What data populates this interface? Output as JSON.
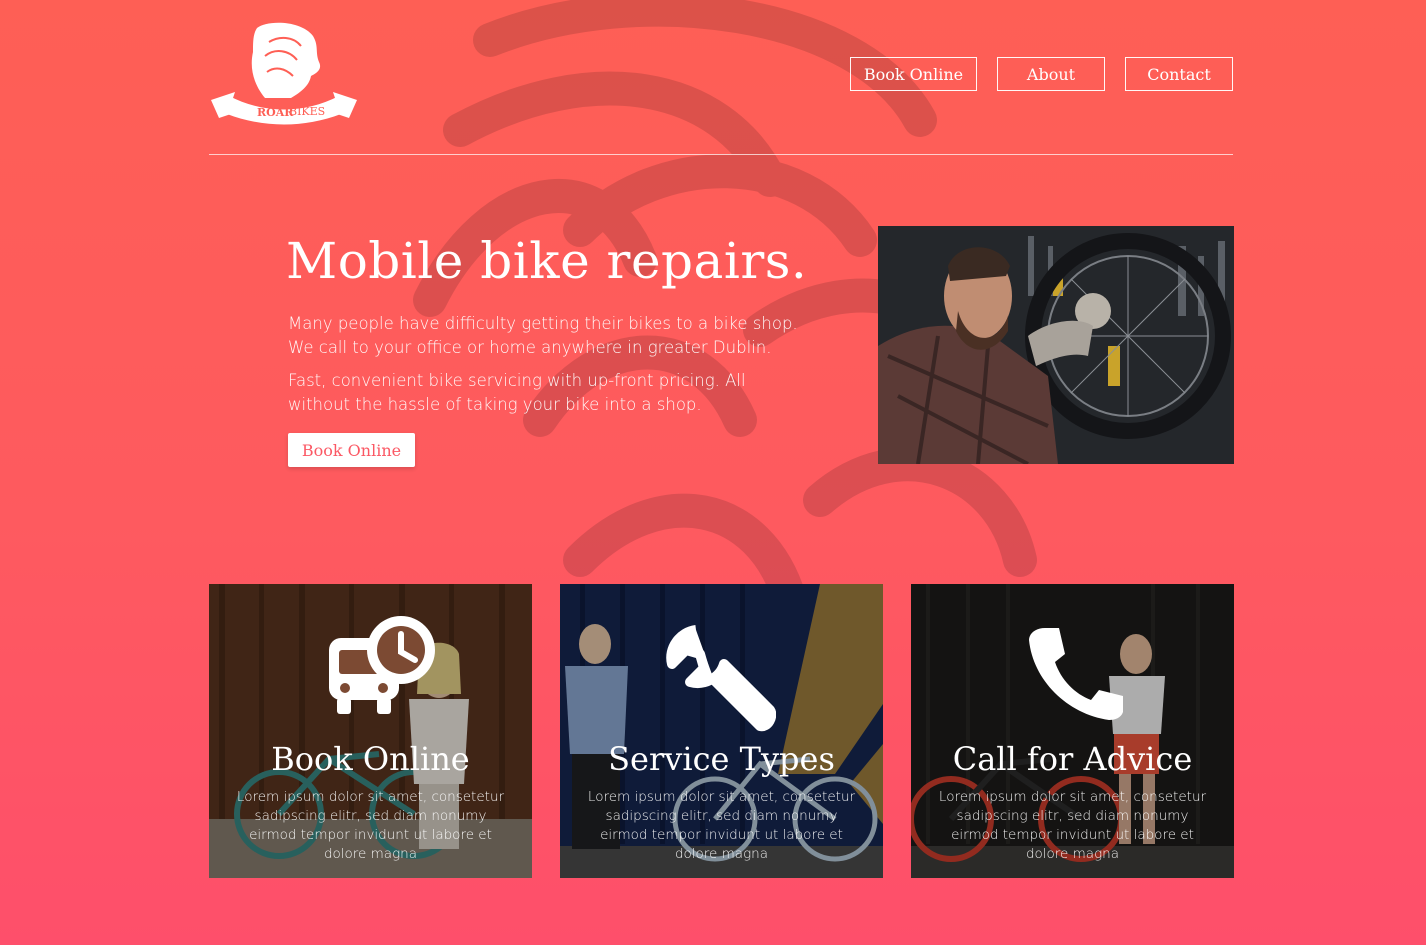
{
  "brand": {
    "logo_word1": "ROAR",
    "logo_word2": "BIKES"
  },
  "nav": {
    "items": [
      {
        "label": "Book Online"
      },
      {
        "label": "About"
      },
      {
        "label": "Contact"
      }
    ]
  },
  "hero": {
    "title": "Mobile bike repairs.",
    "paragraph1": "Many people have difficulty getting their bikes to a bike shop. We call to your office or home anywhere in greater Dublin.",
    "paragraph2": "Fast, convenient bike servicing with up-front pricing. All without the hassle of taking your bike into a shop.",
    "cta_label": "Book Online"
  },
  "cards": [
    {
      "title": "Book Online",
      "text": "Lorem ipsum dolor sit amet, consetetur sadipscing elitr, sed diam nonumy eirmod tempor invidunt ut labore et dolore magna",
      "icon": "bus-clock-icon"
    },
    {
      "title": "Service Types",
      "text": "Lorem ipsum dolor sit amet, consetetur sadipscing elitr, sed diam nonumy eirmod tempor invidunt ut labore et dolore magna",
      "icon": "wrench-icon"
    },
    {
      "title": "Call for Advice",
      "text": "Lorem ipsum dolor sit amet, consetetur sadipscing elitr, sed diam nonumy eirmod tempor invidunt ut labore et dolore magna",
      "icon": "phone-icon"
    }
  ],
  "colors": {
    "background_top": "#fe5f55",
    "background_bottom": "#fe4f6b",
    "accent": "#fb5864"
  }
}
